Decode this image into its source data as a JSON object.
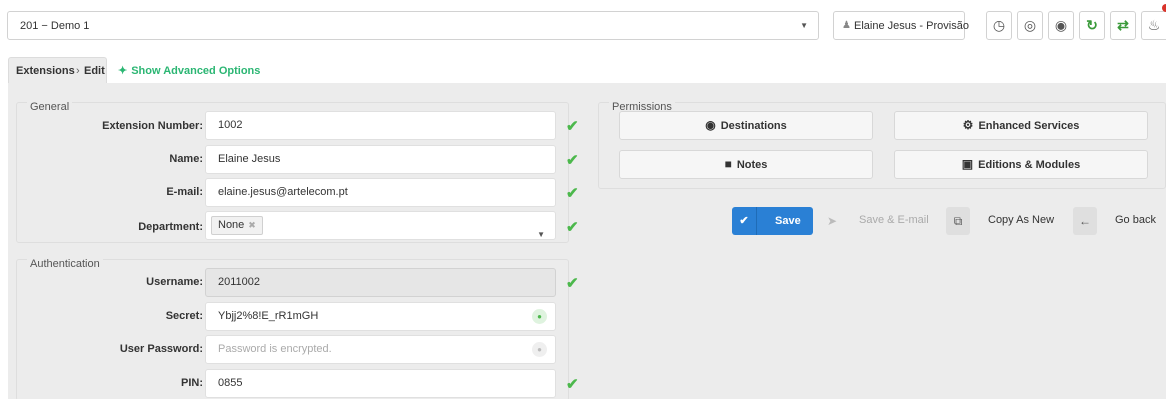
{
  "header": {
    "tenant_value": "201 − Demo 1",
    "user_label": "Elaine Jesus - Provisão",
    "icons": [
      "history-icon",
      "support-icon",
      "globe-icon",
      "reload-icon",
      "sync-icon",
      "bell-icon"
    ]
  },
  "tabs": {
    "breadcrumb_root": "Extensions",
    "breadcrumb_sep": "›",
    "breadcrumb_current": "Edit",
    "advanced_link": "Show Advanced Options"
  },
  "general": {
    "legend": "General",
    "fields": [
      {
        "label": "Extension Number:",
        "value": "1002"
      },
      {
        "label": "Name:",
        "value": "Elaine Jesus"
      },
      {
        "label": "E-mail:",
        "value": "elaine.jesus@artelecom.pt"
      },
      {
        "label": "Department:",
        "value": "None"
      }
    ]
  },
  "authentication": {
    "legend": "Authentication",
    "fields": [
      {
        "label": "Username:",
        "value": "2011002"
      },
      {
        "label": "Secret:",
        "value": "Ybjj2%8!E_rR1mGH"
      },
      {
        "label": "User Password:",
        "placeholder": "Password is encrypted."
      },
      {
        "label": "PIN:",
        "value": "0855"
      }
    ]
  },
  "permissions": {
    "legend": "Permissions",
    "buttons": [
      {
        "label": "Destinations",
        "icon": "globe-icon"
      },
      {
        "label": "Enhanced Services",
        "icon": "gear-icon"
      },
      {
        "label": "Notes",
        "icon": "note-icon"
      },
      {
        "label": "Editions & Modules",
        "icon": "monitor-icon"
      }
    ]
  },
  "actions": {
    "save": "Save",
    "save_email": "Save & E-mail",
    "copy_as_new": "Copy As New",
    "go_back": "Go back"
  },
  "colors": {
    "accent_green": "#2bb673",
    "save_blue": "#2a80d5",
    "check_green": "#4cb84c"
  }
}
